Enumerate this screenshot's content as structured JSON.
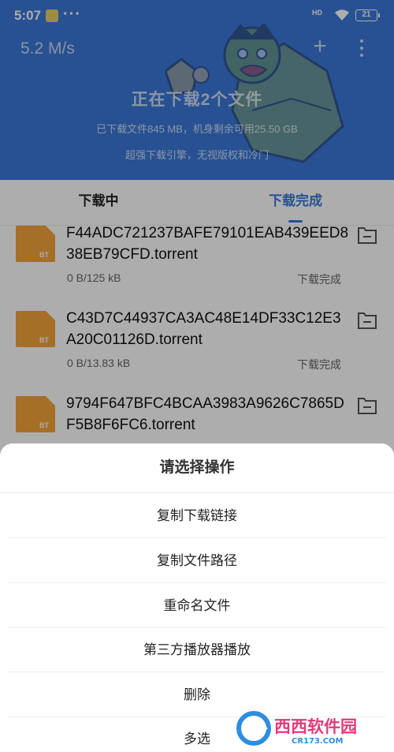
{
  "status_bar": {
    "time": "5:07",
    "dots": "···",
    "network": "HD",
    "battery": "21"
  },
  "header": {
    "speed": "5.2 M/s",
    "add_label": "+",
    "headline": "正在下载2个文件",
    "subline1": "已下载文件845 MB，机身剩余可用25.50 GB",
    "subline2": "超强下载引擎，无视版权和冷门",
    "accent_color": "#3a78d8"
  },
  "tabs": [
    {
      "label": "下载中",
      "active": false
    },
    {
      "label": "下载完成",
      "active": true
    }
  ],
  "files": [
    {
      "name": "F44ADC721237BAFE79101EAB439EED838EB79CFD.torrent",
      "size": "0 B/125 kB",
      "state": "下载完成",
      "type_badge": "BT"
    },
    {
      "name": "C43D7C44937CA3AC48E14DF33C12E3A20C01126D.torrent",
      "size": "0 B/13.83 kB",
      "state": "下载完成",
      "type_badge": "BT"
    },
    {
      "name": "9794F647BFC4BCAA3983A9626C7865DF5B8F6FC6.torrent",
      "size": "",
      "state": "",
      "type_badge": "BT"
    }
  ],
  "action_sheet": {
    "title": "请选择操作",
    "items": [
      "复制下载链接",
      "复制文件路径",
      "重命名文件",
      "第三方播放器播放",
      "删除",
      "多选"
    ]
  },
  "watermark": {
    "brand": "西西软件园",
    "domain": "CR173.COM"
  }
}
